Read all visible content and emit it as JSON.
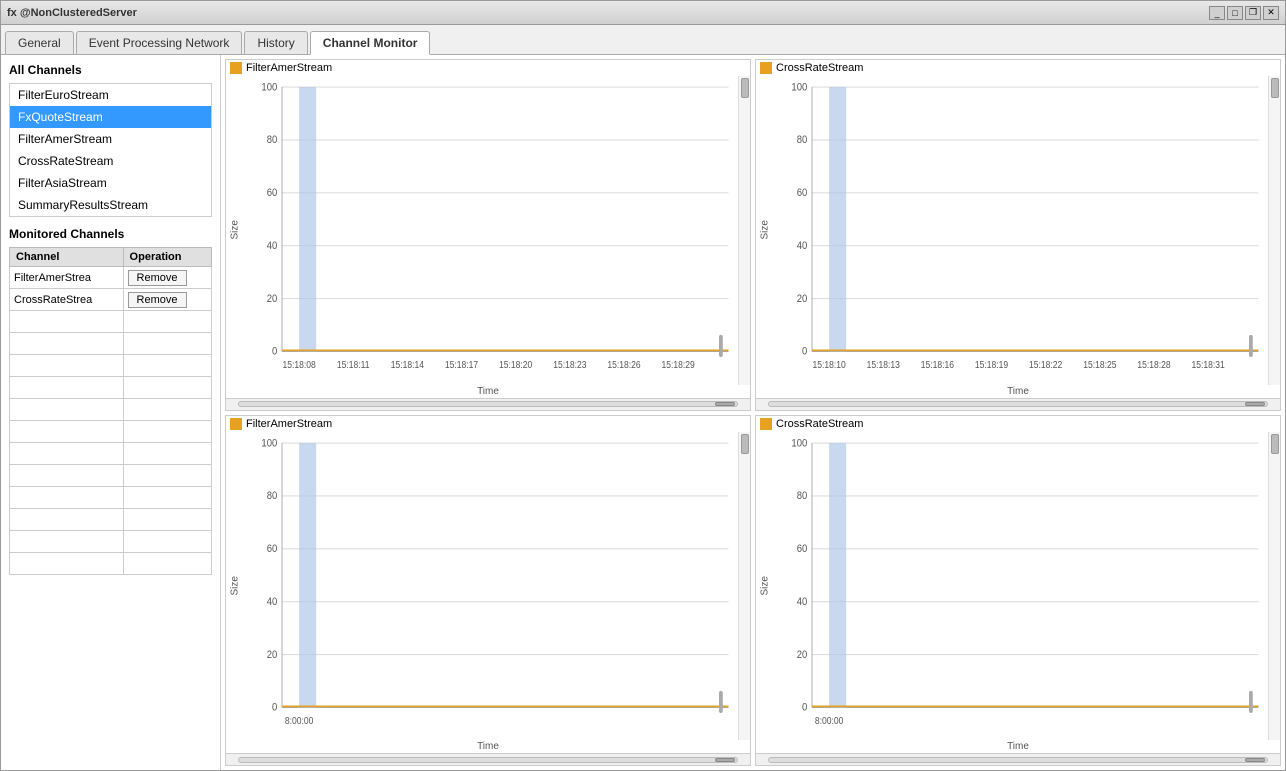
{
  "window": {
    "title": "fx @NonClusteredServer"
  },
  "tabs": [
    {
      "label": "General",
      "active": false
    },
    {
      "label": "Event Processing Network",
      "active": false
    },
    {
      "label": "History",
      "active": false
    },
    {
      "label": "Channel Monitor",
      "active": true
    }
  ],
  "allChannels": {
    "title": "All Channels",
    "items": [
      {
        "name": "FilterEuroStream",
        "selected": false
      },
      {
        "name": "FxQuoteStream",
        "selected": true
      },
      {
        "name": "FilterAmerStream",
        "selected": false
      },
      {
        "name": "CrossRateStream",
        "selected": false
      },
      {
        "name": "FilterAsiaStream",
        "selected": false
      },
      {
        "name": "SummaryResultsStream",
        "selected": false
      }
    ]
  },
  "monitoredChannels": {
    "title": "Monitored Channels",
    "headers": [
      "Channel",
      "Operation"
    ],
    "rows": [
      {
        "channel": "FilterAmerStrea",
        "operation": "Remove"
      },
      {
        "channel": "CrossRateStrea",
        "operation": "Remove"
      }
    ],
    "emptyRows": 12
  },
  "charts": [
    {
      "id": "chart-top-left",
      "legend": "FilterAmerStream",
      "legendColor": "#e8a020",
      "yAxisLabel": "Size",
      "xAxisLabel": "Time",
      "xTickLabels": [
        "15:18:08",
        "15:18:11",
        "15:18:14",
        "15:18:17",
        "15:18:20",
        "15:18:23",
        "15:18:26",
        "15:18:29"
      ],
      "yMax": 100,
      "yTicks": [
        0,
        20,
        40,
        60,
        80,
        100
      ],
      "hasBar": true,
      "barX": 0.06,
      "barHeight": 1.0
    },
    {
      "id": "chart-top-right",
      "legend": "CrossRateStream",
      "legendColor": "#e8a020",
      "yAxisLabel": "Size",
      "xAxisLabel": "Time",
      "xTickLabels": [
        "15:18:10",
        "15:18:13",
        "15:18:16",
        "15:18:19",
        "15:18:22",
        "15:18:25",
        "15:18:28",
        "15:18:31"
      ],
      "yMax": 100,
      "yTicks": [
        0,
        20,
        40,
        60,
        80,
        100
      ],
      "hasBar": true,
      "barX": 0.06,
      "barHeight": 1.0
    },
    {
      "id": "chart-bottom-left",
      "legend": "FilterAmerStream",
      "legendColor": "#e8a020",
      "yAxisLabel": "Size",
      "xAxisLabel": "Time",
      "xTickLabels": [
        "8:00:00"
      ],
      "yMax": 100,
      "yTicks": [
        0,
        20,
        40,
        60,
        80,
        100
      ],
      "hasBar": true,
      "barX": 0.06,
      "barHeight": 1.0
    },
    {
      "id": "chart-bottom-right",
      "legend": "CrossRateStream",
      "legendColor": "#e8a020",
      "yAxisLabel": "Size",
      "xAxisLabel": "Time",
      "xTickLabels": [
        "8:00:00"
      ],
      "yMax": 100,
      "yTicks": [
        0,
        20,
        40,
        60,
        80,
        100
      ],
      "hasBar": true,
      "barX": 0.06,
      "barHeight": 1.0
    }
  ],
  "icons": {
    "minimize": "_",
    "maximize": "□",
    "restore": "❐",
    "close": "✕"
  }
}
